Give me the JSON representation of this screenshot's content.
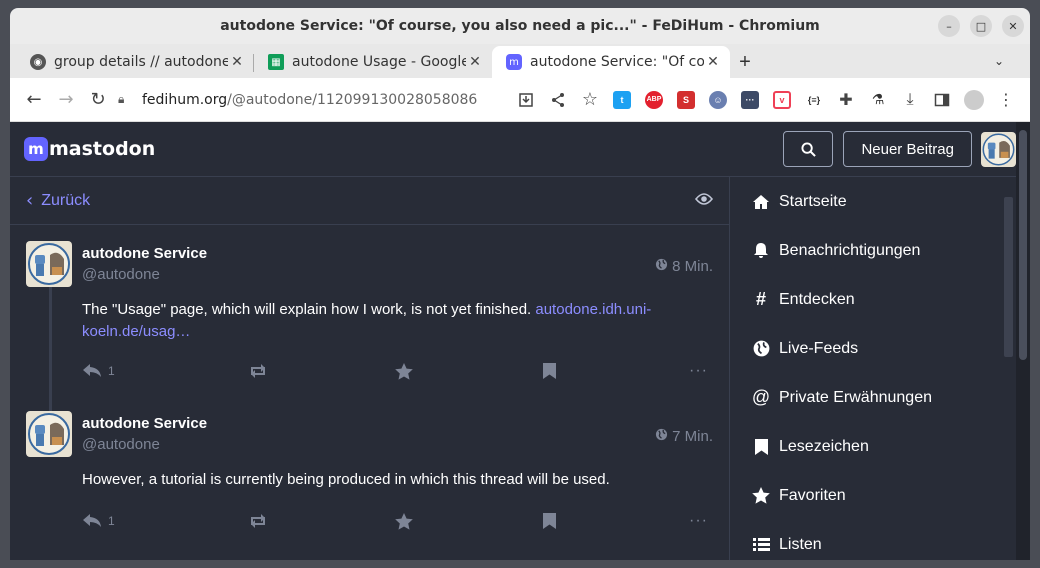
{
  "window": {
    "title": "autodone Service: \"Of course, you also need a pic...\" - FeDiHum - Chromium"
  },
  "tabs": [
    {
      "title": "group details // autodone",
      "active": false
    },
    {
      "title": "autodone Usage - Google",
      "active": false
    },
    {
      "title": "autodone Service: \"Of co",
      "active": true
    }
  ],
  "address": {
    "host": "fedihum.org",
    "path": "/@autodone/112099130028058086"
  },
  "extensions": [
    "twitter-ext",
    "abp-ext",
    "s-ext",
    "user-ext",
    "dots-ext",
    "pocket-ext",
    "json-ext",
    "puzzle-ext",
    "flask-ext",
    "download-ext",
    "sidepanel-ext",
    "profile-ext",
    "menu-ext"
  ],
  "mastodon": {
    "logo_text": "mastodon",
    "new_post": "Neuer Beitrag",
    "back": "Zurück",
    "statuses": [
      {
        "display_name": "autodone Service",
        "acct": "@autodone",
        "time": "8 Min.",
        "text": "The \"Usage\" page, which will explain how I work, is not yet finished. ",
        "link": "autodone.idh.uni-koeln.de/usag…",
        "replies": "1"
      },
      {
        "display_name": "autodone Service",
        "acct": "@autodone",
        "time": "7 Min.",
        "text": "However, a tutorial is currently being produced in which this thread will be used.",
        "link": "",
        "replies": "1"
      }
    ],
    "nav": [
      {
        "icon": "home-icon",
        "label": "Startseite"
      },
      {
        "icon": "bell-icon",
        "label": "Benachrichtigungen"
      },
      {
        "icon": "hashtag-icon",
        "label": "Entdecken"
      },
      {
        "icon": "globe-icon",
        "label": "Live-Feeds"
      },
      {
        "icon": "at-icon",
        "label": "Private Erwähnungen"
      },
      {
        "icon": "bookmark-icon",
        "label": "Lesezeichen"
      },
      {
        "icon": "star-icon",
        "label": "Favoriten"
      },
      {
        "icon": "list-icon",
        "label": "Listen"
      }
    ]
  },
  "colors": {
    "accent": "#8c8dff",
    "background": "#282c37",
    "border": "#393f4f",
    "muted": "#7e8596"
  }
}
